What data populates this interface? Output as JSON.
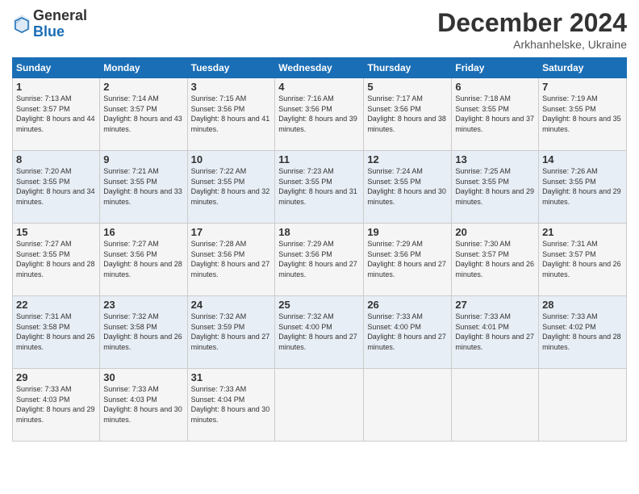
{
  "logo": {
    "general": "General",
    "blue": "Blue"
  },
  "header": {
    "month": "December 2024",
    "location": "Arkhanhelske, Ukraine"
  },
  "days_of_week": [
    "Sunday",
    "Monday",
    "Tuesday",
    "Wednesday",
    "Thursday",
    "Friday",
    "Saturday"
  ],
  "weeks": [
    [
      {
        "day": "1",
        "sunrise": "7:13 AM",
        "sunset": "3:57 PM",
        "daylight": "8 hours and 44 minutes."
      },
      {
        "day": "2",
        "sunrise": "7:14 AM",
        "sunset": "3:57 PM",
        "daylight": "8 hours and 43 minutes."
      },
      {
        "day": "3",
        "sunrise": "7:15 AM",
        "sunset": "3:56 PM",
        "daylight": "8 hours and 41 minutes."
      },
      {
        "day": "4",
        "sunrise": "7:16 AM",
        "sunset": "3:56 PM",
        "daylight": "8 hours and 39 minutes."
      },
      {
        "day": "5",
        "sunrise": "7:17 AM",
        "sunset": "3:56 PM",
        "daylight": "8 hours and 38 minutes."
      },
      {
        "day": "6",
        "sunrise": "7:18 AM",
        "sunset": "3:55 PM",
        "daylight": "8 hours and 37 minutes."
      },
      {
        "day": "7",
        "sunrise": "7:19 AM",
        "sunset": "3:55 PM",
        "daylight": "8 hours and 35 minutes."
      }
    ],
    [
      {
        "day": "8",
        "sunrise": "7:20 AM",
        "sunset": "3:55 PM",
        "daylight": "8 hours and 34 minutes."
      },
      {
        "day": "9",
        "sunrise": "7:21 AM",
        "sunset": "3:55 PM",
        "daylight": "8 hours and 33 minutes."
      },
      {
        "day": "10",
        "sunrise": "7:22 AM",
        "sunset": "3:55 PM",
        "daylight": "8 hours and 32 minutes."
      },
      {
        "day": "11",
        "sunrise": "7:23 AM",
        "sunset": "3:55 PM",
        "daylight": "8 hours and 31 minutes."
      },
      {
        "day": "12",
        "sunrise": "7:24 AM",
        "sunset": "3:55 PM",
        "daylight": "8 hours and 30 minutes."
      },
      {
        "day": "13",
        "sunrise": "7:25 AM",
        "sunset": "3:55 PM",
        "daylight": "8 hours and 29 minutes."
      },
      {
        "day": "14",
        "sunrise": "7:26 AM",
        "sunset": "3:55 PM",
        "daylight": "8 hours and 29 minutes."
      }
    ],
    [
      {
        "day": "15",
        "sunrise": "7:27 AM",
        "sunset": "3:55 PM",
        "daylight": "8 hours and 28 minutes."
      },
      {
        "day": "16",
        "sunrise": "7:27 AM",
        "sunset": "3:56 PM",
        "daylight": "8 hours and 28 minutes."
      },
      {
        "day": "17",
        "sunrise": "7:28 AM",
        "sunset": "3:56 PM",
        "daylight": "8 hours and 27 minutes."
      },
      {
        "day": "18",
        "sunrise": "7:29 AM",
        "sunset": "3:56 PM",
        "daylight": "8 hours and 27 minutes."
      },
      {
        "day": "19",
        "sunrise": "7:29 AM",
        "sunset": "3:56 PM",
        "daylight": "8 hours and 27 minutes."
      },
      {
        "day": "20",
        "sunrise": "7:30 AM",
        "sunset": "3:57 PM",
        "daylight": "8 hours and 26 minutes."
      },
      {
        "day": "21",
        "sunrise": "7:31 AM",
        "sunset": "3:57 PM",
        "daylight": "8 hours and 26 minutes."
      }
    ],
    [
      {
        "day": "22",
        "sunrise": "7:31 AM",
        "sunset": "3:58 PM",
        "daylight": "8 hours and 26 minutes."
      },
      {
        "day": "23",
        "sunrise": "7:32 AM",
        "sunset": "3:58 PM",
        "daylight": "8 hours and 26 minutes."
      },
      {
        "day": "24",
        "sunrise": "7:32 AM",
        "sunset": "3:59 PM",
        "daylight": "8 hours and 27 minutes."
      },
      {
        "day": "25",
        "sunrise": "7:32 AM",
        "sunset": "4:00 PM",
        "daylight": "8 hours and 27 minutes."
      },
      {
        "day": "26",
        "sunrise": "7:33 AM",
        "sunset": "4:00 PM",
        "daylight": "8 hours and 27 minutes."
      },
      {
        "day": "27",
        "sunrise": "7:33 AM",
        "sunset": "4:01 PM",
        "daylight": "8 hours and 27 minutes."
      },
      {
        "day": "28",
        "sunrise": "7:33 AM",
        "sunset": "4:02 PM",
        "daylight": "8 hours and 28 minutes."
      }
    ],
    [
      {
        "day": "29",
        "sunrise": "7:33 AM",
        "sunset": "4:03 PM",
        "daylight": "8 hours and 29 minutes."
      },
      {
        "day": "30",
        "sunrise": "7:33 AM",
        "sunset": "4:03 PM",
        "daylight": "8 hours and 30 minutes."
      },
      {
        "day": "31",
        "sunrise": "7:33 AM",
        "sunset": "4:04 PM",
        "daylight": "8 hours and 30 minutes."
      },
      null,
      null,
      null,
      null
    ]
  ]
}
